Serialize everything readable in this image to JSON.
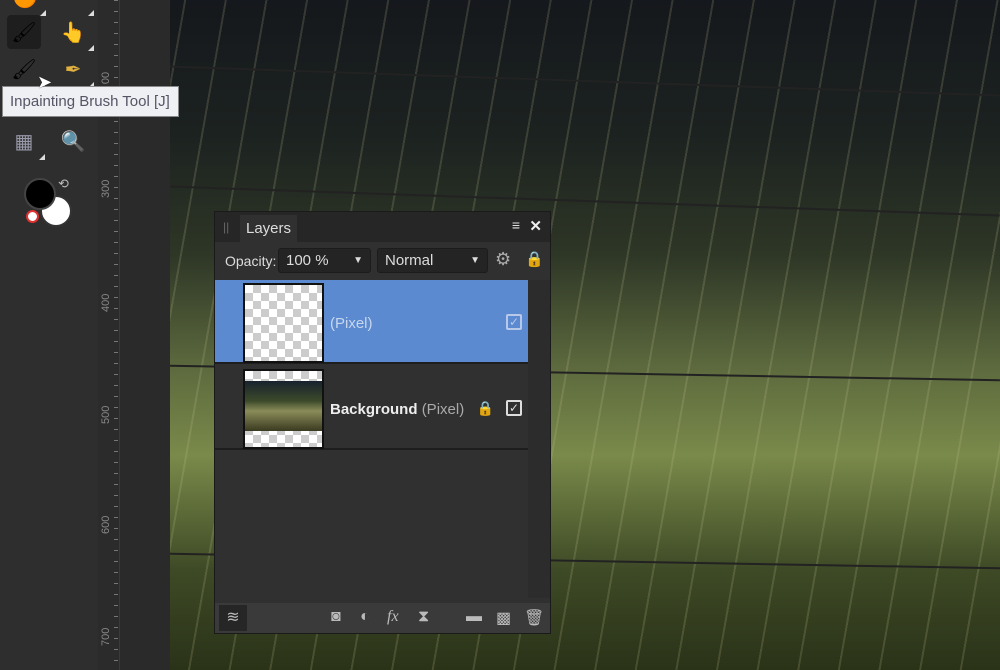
{
  "tooltip": "Inpainting Brush Tool [J]",
  "ruler": {
    "labels": [
      "00",
      "300",
      "400",
      "500",
      "600",
      "700"
    ]
  },
  "tools": [
    {
      "name": "paint-mixer",
      "glyph": "🖌"
    },
    {
      "name": "smudge",
      "glyph": "👆"
    },
    {
      "name": "inpainting-brush",
      "glyph": "🖌"
    },
    {
      "name": "pen",
      "glyph": "✒"
    },
    {
      "name": "mesh-warp",
      "glyph": "▦"
    },
    {
      "name": "zoom",
      "glyph": "🔍"
    }
  ],
  "layers_panel": {
    "tab": "Layers",
    "opacity_label": "Opacity:",
    "opacity_value": "100 %",
    "blend_mode": "Normal",
    "layers": [
      {
        "name": "",
        "type": "(Pixel)",
        "selected": true,
        "visible": true,
        "locked": false
      },
      {
        "name": "Background",
        "type": "(Pixel)",
        "selected": false,
        "visible": true,
        "locked": true
      }
    ]
  },
  "colors": {
    "selection": "#5b8ad0",
    "panel": "#303030"
  }
}
